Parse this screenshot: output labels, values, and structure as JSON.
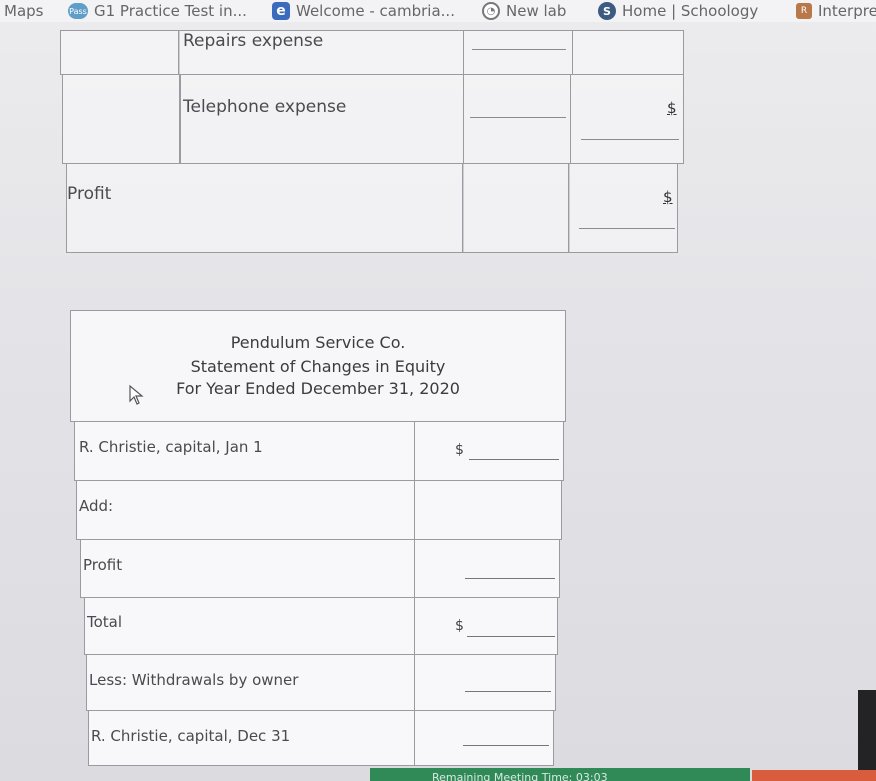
{
  "bookmarks": {
    "maps": "Maps",
    "practice_test": "G1 Practice Test in...",
    "welcome": "Welcome - cambria...",
    "new_lab": "New lab",
    "schoology": "Home | Schoology",
    "interpret": "Interpre",
    "icons": [
      "pass-icon",
      "edu-icon",
      "lab-icon",
      "schoology-icon",
      "interpret-icon"
    ]
  },
  "income_table": {
    "rows": [
      {
        "label": "Repairs expense"
      },
      {
        "label": "Telephone expense",
        "dollar": "$"
      },
      {
        "label": "Profit",
        "dollar": "$"
      }
    ]
  },
  "statement": {
    "company": "Pendulum Service Co.",
    "title": "Statement of Changes in Equity",
    "period": "For Year Ended December 31, 2020",
    "rows": [
      {
        "label": "R. Christie, capital, Jan 1",
        "dollar": "$"
      },
      {
        "label": "Add:"
      },
      {
        "label": "Profit"
      },
      {
        "label": "Total",
        "dollar": "$"
      },
      {
        "label": "Less: Withdrawals by owner"
      },
      {
        "label": "R. Christie, capital, Dec 31"
      }
    ]
  },
  "footer": {
    "remaining": "Remaining Meeting Time: 03:03"
  }
}
